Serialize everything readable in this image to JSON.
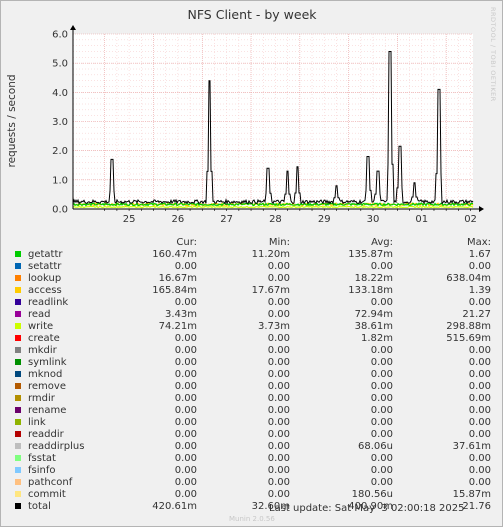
{
  "chart_data": {
    "type": "line",
    "title": "NFS Client - by week",
    "ylabel": "requests / second",
    "ylim": [
      0,
      6.0
    ],
    "yticks": [
      "0.0",
      "1.0",
      "2.0",
      "3.0",
      "4.0",
      "5.0",
      "6.0"
    ],
    "xticks": [
      "25",
      "26",
      "27",
      "28",
      "29",
      "30",
      "01",
      "02"
    ],
    "grid": true,
    "series": [
      {
        "name": "total",
        "color": "#000000",
        "peaks": [
          {
            "day": 25.15,
            "value": 1.7
          },
          {
            "day": 27.15,
            "value": 4.4
          },
          {
            "day": 28.35,
            "value": 1.4
          },
          {
            "day": 28.75,
            "value": 1.3
          },
          {
            "day": 28.95,
            "value": 1.45
          },
          {
            "day": 29.75,
            "value": 0.8
          },
          {
            "day": 30.4,
            "value": 1.8
          },
          {
            "day": 30.6,
            "value": 1.3
          },
          {
            "day": 30.85,
            "value": 5.4
          },
          {
            "day": 31.05,
            "value": 2.15
          },
          {
            "day": 31.35,
            "value": 0.9
          },
          {
            "day": 31.85,
            "value": 4.1
          }
        ],
        "baseline": 0.25
      },
      {
        "name": "write",
        "color": "#ccff00",
        "baseline": 0.07
      },
      {
        "name": "getattr",
        "color": "#00cc00",
        "baseline": 0.16
      },
      {
        "name": "access",
        "color": "#ffcc00",
        "baseline": 0.16
      }
    ]
  },
  "side_text": "RRDTOOL / TOBI OETIKER",
  "legend": {
    "headers": {
      "cur": "Cur:",
      "min": "Min:",
      "avg": "Avg:",
      "max": "Max:"
    },
    "rows": [
      {
        "name": "getattr",
        "color": "#00cc00",
        "cur": "160.47m",
        "min": "11.20m",
        "avg": "135.87m",
        "max": "1.67"
      },
      {
        "name": "setattr",
        "color": "#0066b3",
        "cur": "0.00",
        "min": "0.00",
        "avg": "0.00",
        "max": "0.00"
      },
      {
        "name": "lookup",
        "color": "#ff8000",
        "cur": "16.67m",
        "min": "0.00",
        "avg": "18.22m",
        "max": "638.04m"
      },
      {
        "name": "access",
        "color": "#ffcc00",
        "cur": "165.84m",
        "min": "17.67m",
        "avg": "133.18m",
        "max": "1.39"
      },
      {
        "name": "readlink",
        "color": "#330099",
        "cur": "0.00",
        "min": "0.00",
        "avg": "0.00",
        "max": "0.00"
      },
      {
        "name": "read",
        "color": "#990099",
        "cur": "3.43m",
        "min": "0.00",
        "avg": "72.94m",
        "max": "21.27"
      },
      {
        "name": "write",
        "color": "#ccff00",
        "cur": "74.21m",
        "min": "3.73m",
        "avg": "38.61m",
        "max": "298.88m"
      },
      {
        "name": "create",
        "color": "#ff0000",
        "cur": "0.00",
        "min": "0.00",
        "avg": "1.82m",
        "max": "515.69m"
      },
      {
        "name": "mkdir",
        "color": "#808080",
        "cur": "0.00",
        "min": "0.00",
        "avg": "0.00",
        "max": "0.00"
      },
      {
        "name": "symlink",
        "color": "#008f00",
        "cur": "0.00",
        "min": "0.00",
        "avg": "0.00",
        "max": "0.00"
      },
      {
        "name": "mknod",
        "color": "#00487d",
        "cur": "0.00",
        "min": "0.00",
        "avg": "0.00",
        "max": "0.00"
      },
      {
        "name": "remove",
        "color": "#b35a00",
        "cur": "0.00",
        "min": "0.00",
        "avg": "0.00",
        "max": "0.00"
      },
      {
        "name": "rmdir",
        "color": "#b38f00",
        "cur": "0.00",
        "min": "0.00",
        "avg": "0.00",
        "max": "0.00"
      },
      {
        "name": "rename",
        "color": "#6b006b",
        "cur": "0.00",
        "min": "0.00",
        "avg": "0.00",
        "max": "0.00"
      },
      {
        "name": "link",
        "color": "#8fb300",
        "cur": "0.00",
        "min": "0.00",
        "avg": "0.00",
        "max": "0.00"
      },
      {
        "name": "readdir",
        "color": "#b30000",
        "cur": "0.00",
        "min": "0.00",
        "avg": "0.00",
        "max": "0.00"
      },
      {
        "name": "readdirplus",
        "color": "#bebebe",
        "cur": "0.00",
        "min": "0.00",
        "avg": "68.06u",
        "max": "37.61m"
      },
      {
        "name": "fsstat",
        "color": "#80ff80",
        "cur": "0.00",
        "min": "0.00",
        "avg": "0.00",
        "max": "0.00"
      },
      {
        "name": "fsinfo",
        "color": "#80c9ff",
        "cur": "0.00",
        "min": "0.00",
        "avg": "0.00",
        "max": "0.00"
      },
      {
        "name": "pathconf",
        "color": "#ffc080",
        "cur": "0.00",
        "min": "0.00",
        "avg": "0.00",
        "max": "0.00"
      },
      {
        "name": "commit",
        "color": "#ffe680",
        "cur": "0.00",
        "min": "0.00",
        "avg": "180.56u",
        "max": "15.87m"
      },
      {
        "name": "total",
        "color": "#000000",
        "cur": "420.61m",
        "min": "32.60m",
        "avg": "400.90m",
        "max": "21.76"
      }
    ]
  },
  "last_update": "Last update: Sat May  3 02:00:18 2025",
  "footer": "Munin 2.0.56"
}
